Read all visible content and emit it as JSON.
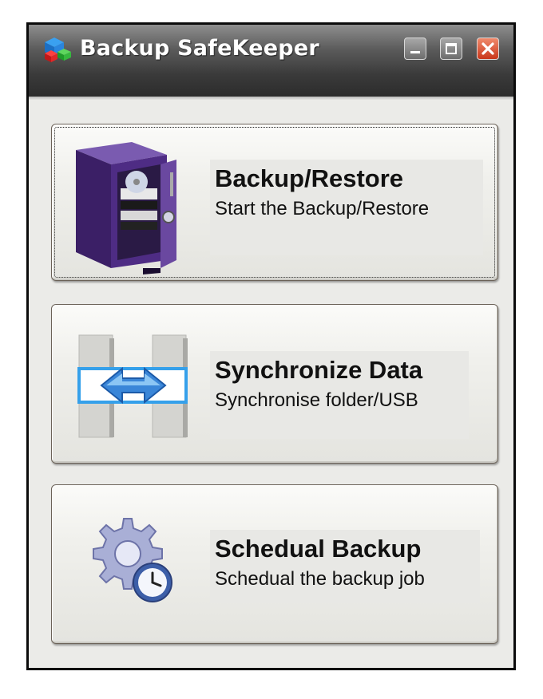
{
  "window": {
    "title": "Backup SafeKeeper",
    "controls": {
      "minimize": "minimize-button",
      "maximize": "maximize-button",
      "close": "close-button"
    }
  },
  "actions": [
    {
      "heading": "Backup/Restore",
      "subtitle": "Start the Backup/Restore",
      "icon": "safe-icon",
      "focused": true
    },
    {
      "heading": "Synchronize Data",
      "subtitle": "Synchronise folder/USB",
      "icon": "sync-arrows-icon",
      "focused": false
    },
    {
      "heading": "Schedual Backup",
      "subtitle": "Schedual the backup job",
      "icon": "gear-clock-icon",
      "focused": false
    }
  ],
  "colors": {
    "titlebar": "#3a3a3a",
    "close": "#c9371b",
    "safe": "#4b2a7a",
    "sync": "#3a86d8",
    "gear": "#9aa0c8"
  }
}
